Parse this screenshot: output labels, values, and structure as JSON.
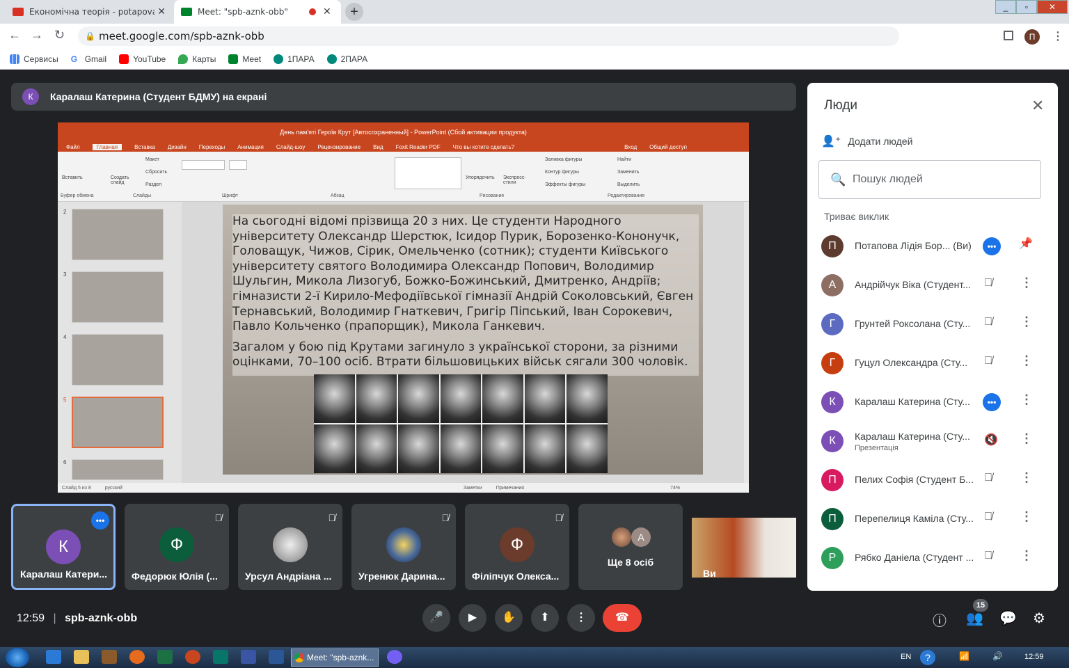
{
  "browser": {
    "tabs": [
      {
        "title": "Економічна теорія - potapova.li",
        "close": "✕"
      },
      {
        "title": "Meet: \"spb-aznk-obb\"",
        "close": "✕"
      }
    ],
    "new_tab": "+",
    "url": "meet.google.com/spb-aznk-obb",
    "profile_initial": "П",
    "bookmarks": [
      "Сервисы",
      "Gmail",
      "YouTube",
      "Карты",
      "Meet",
      "1ПАРА",
      "2ПАРА"
    ]
  },
  "banner": {
    "avatar": "К",
    "text": "Каралаш Катерина (Студент БДМУ) на екрані"
  },
  "ppt": {
    "title": "День пам'яті Героїв Крут [Автосохраненный] - PowerPoint (Сбой активации продукта)",
    "menu": [
      "Файл",
      "Главная",
      "Вставка",
      "Дизайн",
      "Переходы",
      "Анимация",
      "Слайд-шоу",
      "Рецензирование",
      "Вид",
      "Foxit Reader PDF",
      "Что вы хотите сделать?",
      "Вход",
      "Общий доступ"
    ],
    "ribbon_groups": [
      "Буфер обмена",
      "Слайды",
      "Шрифт",
      "Абзац",
      "Рисование",
      "Редактирование"
    ],
    "ribbon_items": [
      "Вставить",
      "Создать слайд",
      "Макет",
      "Сбросить",
      "Раздел",
      "Упорядочить",
      "Экспресс-стили",
      "Заливка фигуры",
      "Контур фигуры",
      "Эффекты фигуры",
      "Найти",
      "Заменить",
      "Выделить"
    ],
    "thumb_numbers": [
      "2",
      "3",
      "4",
      "5",
      "6"
    ],
    "slide_paragraph1": "На сьогодні відомі прізвища 20 з них. Це студенти Народного університету Олександр Шерстюк, Ісидор Пурик, Борозенко-Кононучк, Головащук, Чижов, Сірик, Омельченко (сотник); студенти Київського університету святого Володимира Олександр Попович, Володимир Шульгин, Микола Лизогуб, Божко-Божинський, Дмитренко, Андріїв; гімназисти 2-ї Кирило-Мефодіївської гімназії Андрій Соколовський, Євген Тернавський, Володимир Гнаткевич, Григір Піпський, Іван Сорокевич, Павло Кольченко (прапорщик), Микола Ганкевич.",
    "slide_paragraph2": "Загалом у бою під Крутами загинуло з української сторони, за різними оцінками, 70–100 осіб. Втрати більшовицьких військ сягали 300 чоловік.",
    "status": {
      "slide": "Слайд 5 из 8",
      "lang": "русский",
      "notes": "Заметки",
      "comments": "Примечания",
      "zoom": "74%"
    }
  },
  "tiles": [
    {
      "initial": "К",
      "name": "Каралаш Катери...",
      "color": "#7b4fb5"
    },
    {
      "initial": "Ф",
      "name": "Федорюк Юлія (...",
      "color": "#0b5d3b"
    },
    {
      "initial": "",
      "name": "Урсул Андріана ...",
      "color": "#9a9a9a"
    },
    {
      "initial": "",
      "name": "Угренюк Дарина...",
      "color": "#4a6a9a"
    },
    {
      "initial": "Ф",
      "name": "Філіпчук Олекса...",
      "color": "#6b3b2b"
    },
    {
      "initial": "A",
      "name": "Ще 8 осіб",
      "color": "#9c8a85"
    },
    {
      "initial": "",
      "name": "Ви",
      "color": "#c98a4a"
    }
  ],
  "people": {
    "title": "Люди",
    "add": "Додати людей",
    "search_placeholder": "Пошук людей",
    "section": "Триває виклик",
    "rows": [
      {
        "initial": "П",
        "name": "Потапова Лідія Бор... (Ви)",
        "color": "#5d3b2f",
        "sub": ""
      },
      {
        "initial": "А",
        "name": "Андрійчук Віка (Студент...",
        "color": "#8d6e63",
        "sub": ""
      },
      {
        "initial": "Г",
        "name": "Грунтей Роксолана (Сту...",
        "color": "#5c6bc0",
        "sub": ""
      },
      {
        "initial": "Г",
        "name": "Гуцул Олександра (Сту...",
        "color": "#c63d0f",
        "sub": ""
      },
      {
        "initial": "К",
        "name": "Каралаш Катерина (Сту...",
        "color": "#7b4fb5",
        "sub": ""
      },
      {
        "initial": "К",
        "name": "Каралаш Катерина (Сту...",
        "color": "#7b4fb5",
        "sub": "Презентація"
      },
      {
        "initial": "П",
        "name": "Пелих Софія (Студент Б...",
        "color": "#d81b60",
        "sub": ""
      },
      {
        "initial": "П",
        "name": "Перепелиця Каміла (Сту...",
        "color": "#0b5d3b",
        "sub": ""
      },
      {
        "initial": "Р",
        "name": "Рябко Даніела (Студент ...",
        "color": "#2e9e5b",
        "sub": ""
      }
    ]
  },
  "bottom": {
    "time": "12:59",
    "separator": "|",
    "code": "spb-aznk-obb",
    "participants": "15"
  },
  "taskbar": {
    "meet": "Meet: \"spb-aznk...",
    "lang": "EN",
    "clock": "12:59"
  }
}
